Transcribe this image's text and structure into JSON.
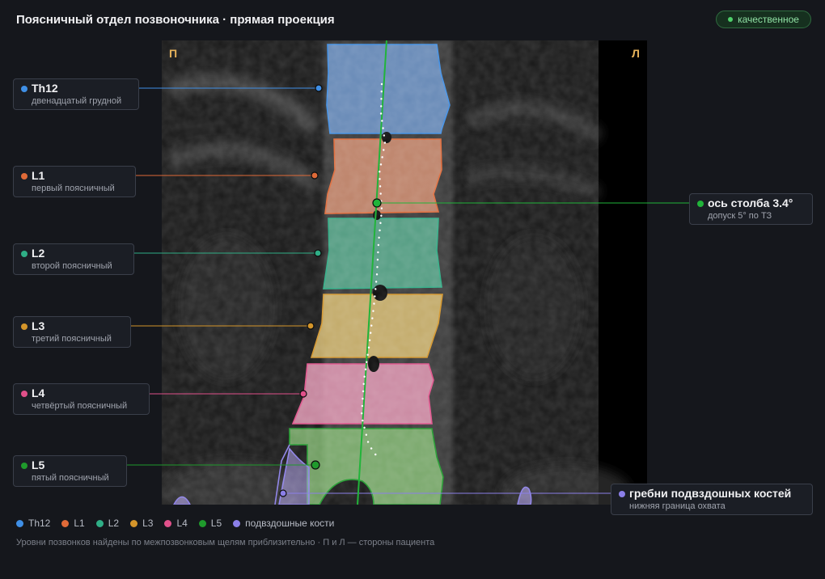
{
  "header": {
    "title": "Поясничный отдел позвоночника · прямая проекция",
    "badge": "качественное"
  },
  "viewer": {
    "side_right": "П",
    "side_left": "Л"
  },
  "colors": {
    "th12": "#3f8fe6",
    "l1": "#e06a38",
    "l2": "#2fae86",
    "l3": "#d4952a",
    "l4": "#e0508a",
    "l5": "#1f9a2c",
    "iliac": "#8b7fe8",
    "axis": "#21b43a"
  },
  "labels": {
    "th12": {
      "name": "Th12",
      "desc": "двенадцатый грудной"
    },
    "l1": {
      "name": "L1",
      "desc": "первый поясничный"
    },
    "l2": {
      "name": "L2",
      "desc": "второй поясничный"
    },
    "l3": {
      "name": "L3",
      "desc": "третий поясничный"
    },
    "l4": {
      "name": "L4",
      "desc": "четвёртый поясничный"
    },
    "l5": {
      "name": "L5",
      "desc": "пятый поясничный"
    },
    "axis": {
      "name": "ось столба 3.4°",
      "desc": "допуск 5° по ТЗ"
    },
    "iliac": {
      "name": "гребни подвздошных костей",
      "desc": "нижняя граница охвата"
    }
  },
  "legend": [
    "Th12",
    "L1",
    "L2",
    "L3",
    "L4",
    "L5",
    "подвздошные кости"
  ],
  "footnote": "Уровни позвонков найдены по межпозвонковым щелям приблизительно · П и Л — стороны пациента"
}
